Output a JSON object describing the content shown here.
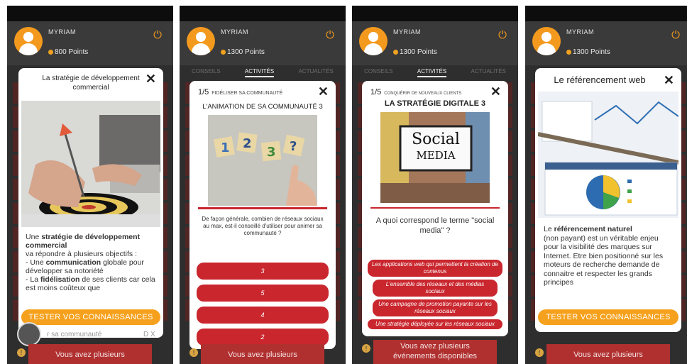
{
  "user": {
    "name": "MYRIAM"
  },
  "screens": [
    {
      "points": "800 Points",
      "modal": {
        "title": "La stratégie de développement commercial",
        "body_lines": [
          {
            "pre": "Une ",
            "bold": "stratégie de développement commercial",
            "post": ""
          },
          {
            "pre": "va répondre à plusieurs objectifs :",
            "bold": "",
            "post": ""
          },
          {
            "pre": "- Une ",
            "bold": "communication",
            "post": " globale pour développer sa notoriété"
          },
          {
            "pre": "- La ",
            "bold": "fidélisation",
            "post": " de ses clients car cela est moins coûteux que"
          }
        ],
        "cta": "TESTER VOS CONNAISSANCES"
      },
      "behind_text": "r sa communauté",
      "behind_side": "D X",
      "bottom": "Vous avez plusieurs"
    },
    {
      "points": "1300 Points",
      "tabs": [
        "CONSEILS",
        "ACTIVITÉS",
        "ACTUALITÉS"
      ],
      "progress": "1/5",
      "category": "FIDÉLISER SA COMMUNAUTÉ",
      "title": "L'ANIMATION DE SA COMMUNAUTÉ 3",
      "question": "De façon générale, combien de réseaux sociaux au max, est-il conseillé d'utiliser pour animer sa communauté ?",
      "answers": [
        "3",
        "5",
        "4",
        "2"
      ],
      "bottom": "Vous avez plusieurs"
    },
    {
      "points": "1300 Points",
      "tabs": [
        "CONSEILS",
        "ACTIVITÉS",
        "ACTUALITÉS"
      ],
      "progress": "1/5",
      "category": "CONQUÉRIR DE NOUVEAUX CLIENTS",
      "title": "LA STRATÉGIE DIGITALE 3",
      "image_text": [
        "Social",
        "MEDIA"
      ],
      "question": "A quoi correspond le terme \"social media\" ?",
      "answers": [
        "Les applications web qui permettent la création de contenus",
        "L'ensemble des réseaux et des médias sociaux",
        "Une campagne de promotion payante sur les réseaux sociaux",
        "Une stratégie déployée sur les réseaux sociaux"
      ],
      "bottom_lines": [
        "Vous avez plusieurs",
        "événements disponibles"
      ]
    },
    {
      "points": "1300 Points",
      "modal": {
        "title": "Le référencement web",
        "body_lines": [
          {
            "pre": "Le ",
            "bold": "référencement naturel",
            "post": ""
          },
          {
            "pre": "(non payant) est un véritable enjeu pour la visibilité des marques sur Internet. Etre bien positionné sur les moteurs de recherche demande de connaitre et respecter les grands principes",
            "bold": "",
            "post": ""
          }
        ],
        "cta": "TESTER VOS CONNAISSANCES"
      },
      "bottom": "Vous avez plusieurs"
    }
  ],
  "colors": {
    "accent": "#f39a1e",
    "answer": "#c9262e",
    "cta": "#f6a11d"
  }
}
